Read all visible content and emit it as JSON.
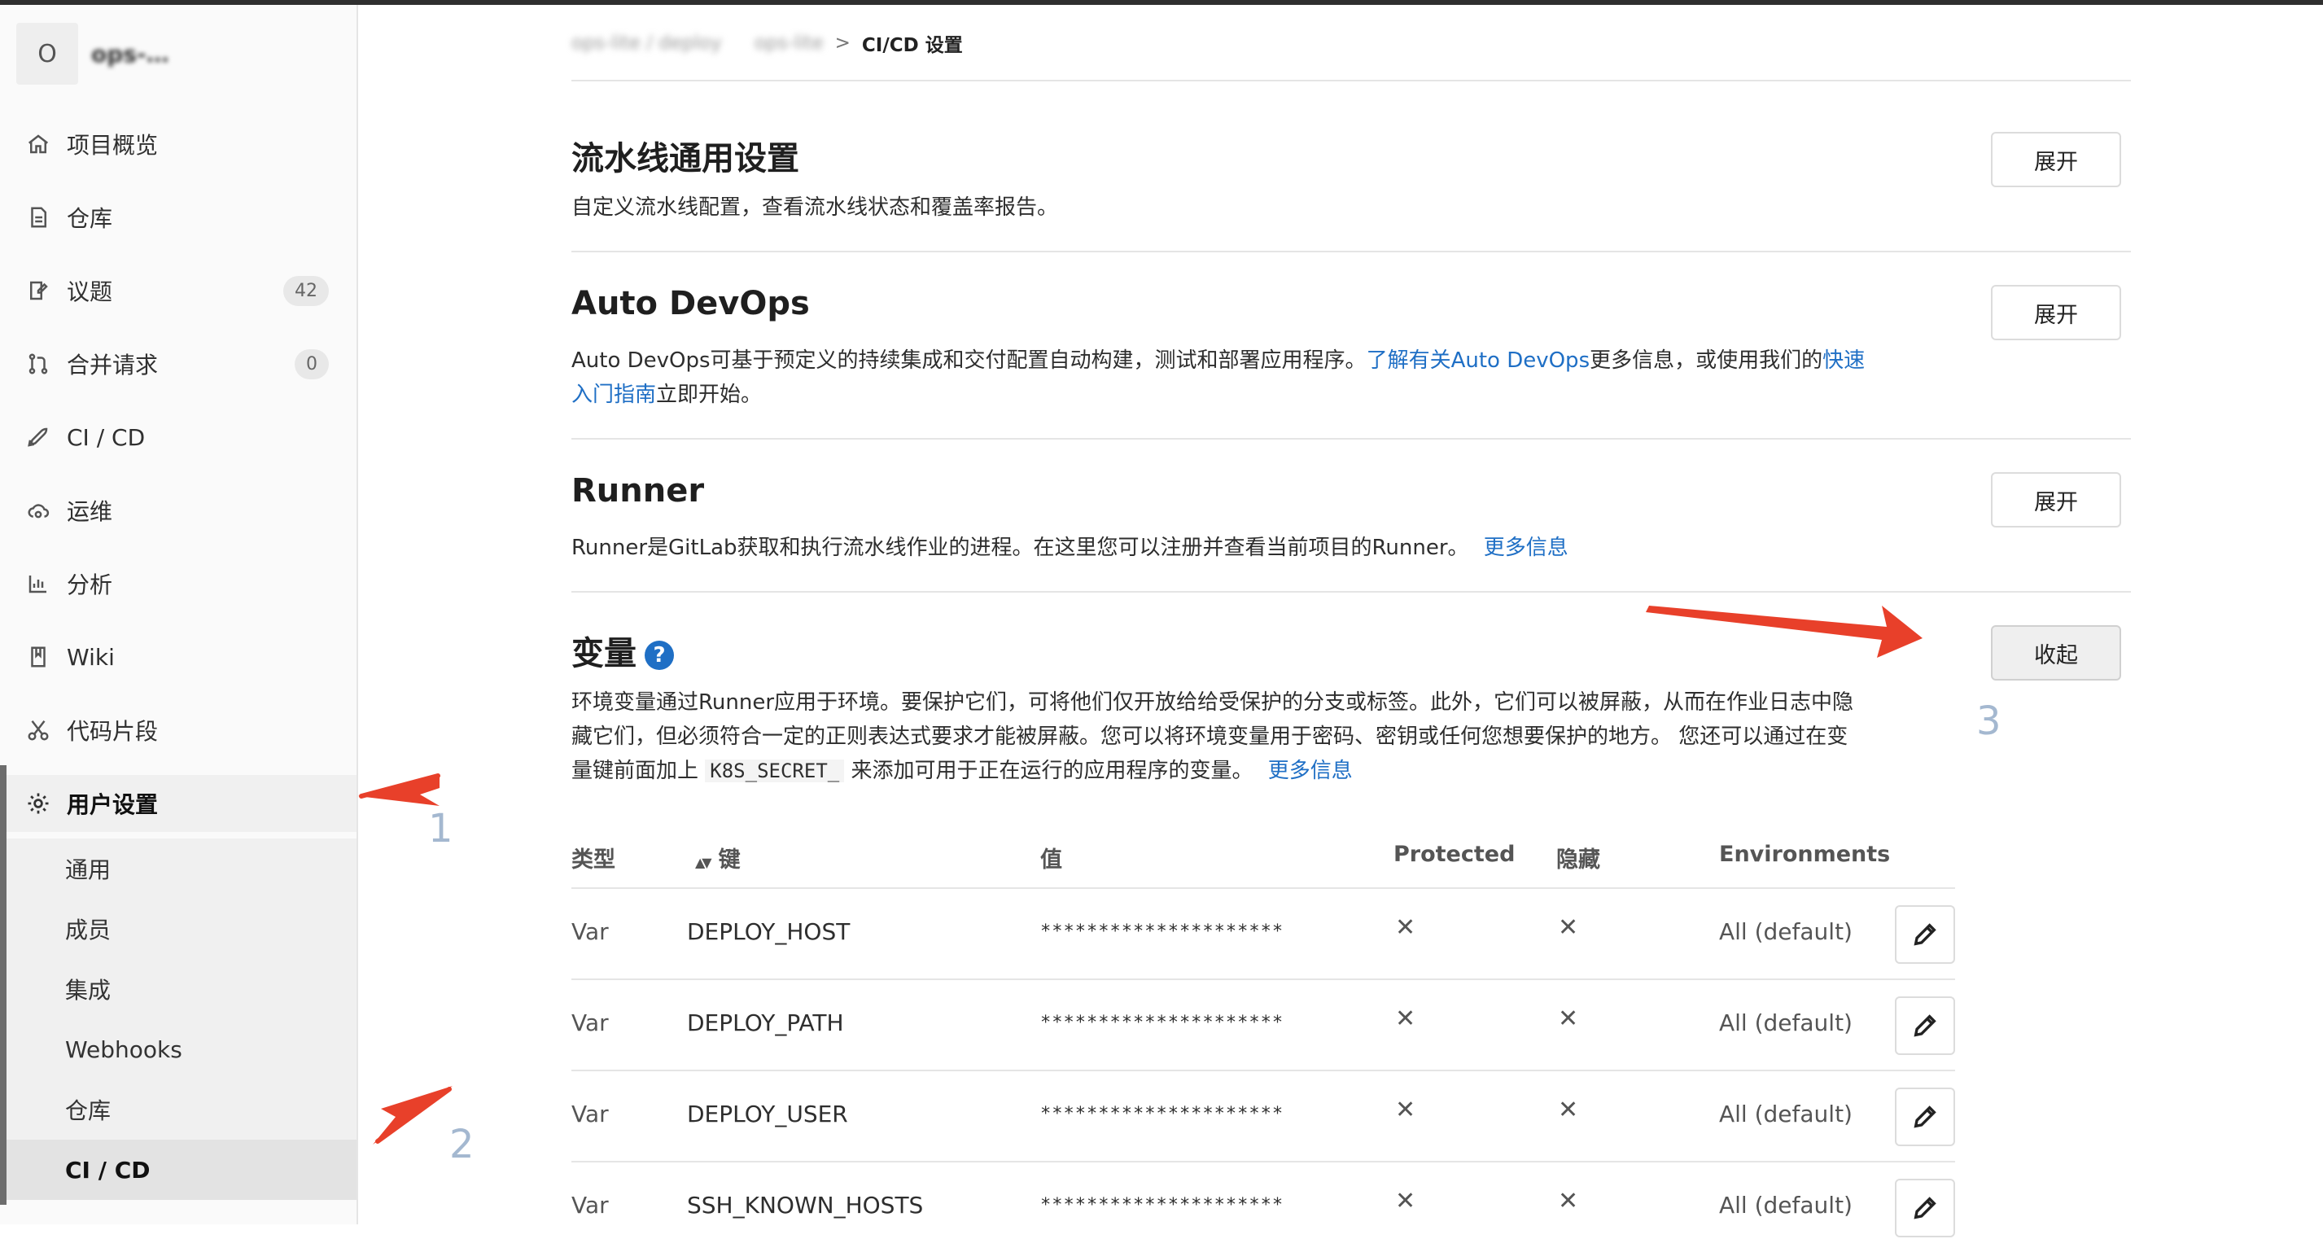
{
  "project": {
    "avatar_letter": "O",
    "name": "ops-…"
  },
  "sidebar": {
    "items": [
      {
        "label": "项目概览",
        "icon": "home-icon"
      },
      {
        "label": "仓库",
        "icon": "document-icon"
      },
      {
        "label": "议题",
        "icon": "issues-icon",
        "count": "42"
      },
      {
        "label": "合并请求",
        "icon": "merge-request-icon",
        "count": "0"
      },
      {
        "label": "CI / CD",
        "icon": "rocket-icon"
      },
      {
        "label": "运维",
        "icon": "cloud-gear-icon"
      },
      {
        "label": "分析",
        "icon": "chart-icon"
      },
      {
        "label": "Wiki",
        "icon": "book-icon"
      },
      {
        "label": "代码片段",
        "icon": "scissors-icon"
      },
      {
        "label": "用户设置",
        "icon": "gear-icon"
      }
    ],
    "settings_sub": [
      "通用",
      "成员",
      "集成",
      "Webhooks",
      "仓库",
      "CI / CD"
    ]
  },
  "breadcrumb": {
    "part1": "ops-lite / deploy",
    "part2": "ops-lite",
    "sep": ">",
    "current": "CI/CD 设置"
  },
  "sections": {
    "pipeline": {
      "title": "流水线通用设置",
      "desc": "自定义流水线配置，查看流水线状态和覆盖率报告。",
      "button": "展开"
    },
    "autodevops": {
      "title": "Auto DevOps",
      "desc_a": "Auto DevOps可基于预定义的持续集成和交付配置自动构建，测试和部署应用程序。",
      "link1": "了解有关Auto DevOps",
      "desc_b": "更多信息，或使用我们的",
      "link2a": "快速",
      "link2b": "入门指南",
      "desc_c": "立即开始。",
      "button": "展开"
    },
    "runner": {
      "title": "Runner",
      "desc": "Runner是GitLab获取和执行流水线作业的进程。在这里您可以注册并查看当前项目的Runner。",
      "link": "更多信息",
      "button": "展开"
    },
    "variables": {
      "title": "变量",
      "help_glyph": "?",
      "desc_line1": "环境变量通过Runner应用于环境。要保护它们，可将他们仅开放给给受保护的分支或标签。此外，它们可以被屏蔽，从而在作业日志中隐",
      "desc_line2": "藏它们，但必须符合一定的正则表达式要求才能被屏蔽。您可以将环境变量用于密码、密钥或任何您想要保护的地方。 您还可以通过在变",
      "desc_line3a": "量键前面加上",
      "code": "K8S_SECRET_",
      "desc_line3b": "来添加可用于正在运行的应用程序的变量。",
      "link": "更多信息",
      "button": "收起"
    }
  },
  "table": {
    "headers": {
      "type": "类型",
      "sort_glyph": "▲▼",
      "key": "键",
      "value": "值",
      "protected": "Protected",
      "masked": "隐藏",
      "env": "Environments"
    },
    "rows": [
      {
        "type": "Var",
        "key": "DEPLOY_HOST",
        "value": "*********************",
        "protected": "✕",
        "masked": "✕",
        "env": "All (default)"
      },
      {
        "type": "Var",
        "key": "DEPLOY_PATH",
        "value": "*********************",
        "protected": "✕",
        "masked": "✕",
        "env": "All (default)"
      },
      {
        "type": "Var",
        "key": "DEPLOY_USER",
        "value": "*********************",
        "protected": "✕",
        "masked": "✕",
        "env": "All (default)"
      },
      {
        "type": "Var",
        "key": "SSH_KNOWN_HOSTS",
        "value": "*********************",
        "protected": "✕",
        "masked": "✕",
        "env": "All (default)"
      }
    ]
  },
  "annotations": {
    "n1": "1",
    "n2": "2",
    "n3": "3",
    "arrow_color": "#e8402a",
    "number_color": "#a4b8d0"
  }
}
